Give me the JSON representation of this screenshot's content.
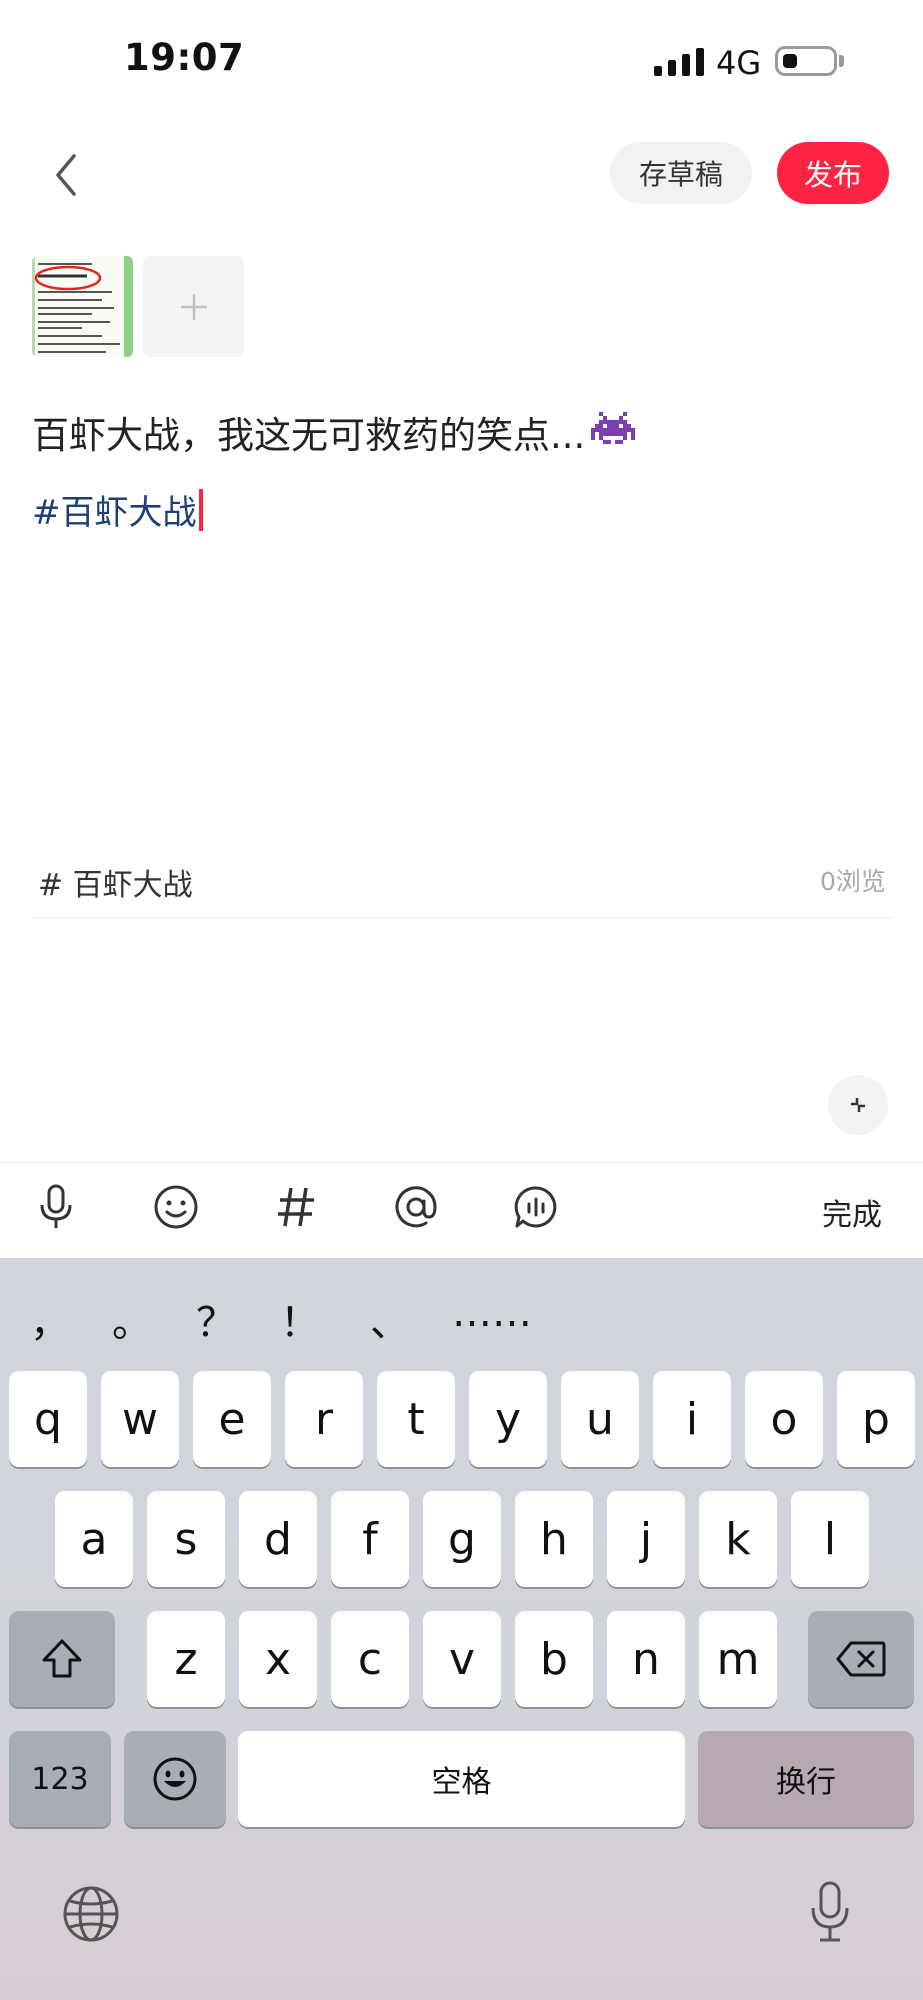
{
  "status_bar": {
    "time": "19:07",
    "network": "4G"
  },
  "header": {
    "draft_label": "存草稿",
    "publish_label": "发布"
  },
  "post": {
    "body_text": "百虾大战，我这无可救药的笑点...",
    "hashtag": "#百虾大战"
  },
  "topic_suggestion": {
    "label": "# 百虾大战",
    "views": "0浏览"
  },
  "toolbar": {
    "done_label": "完成",
    "icons": [
      "mic-icon",
      "emoji-icon",
      "hashtag-icon",
      "mention-icon",
      "voice-chat-icon"
    ]
  },
  "keyboard": {
    "punctuation": [
      "，",
      "。",
      "？",
      "！",
      "、",
      "……"
    ],
    "row1": [
      "q",
      "w",
      "e",
      "r",
      "t",
      "y",
      "u",
      "i",
      "o",
      "p"
    ],
    "row2": [
      "a",
      "s",
      "d",
      "f",
      "g",
      "h",
      "j",
      "k",
      "l"
    ],
    "row3": [
      "z",
      "x",
      "c",
      "v",
      "b",
      "n",
      "m"
    ],
    "numbers_label": "123",
    "space_label": "空格",
    "return_label": "换行"
  },
  "colors": {
    "accent": "#ff2442",
    "hashtag": "#1c3f7a"
  }
}
